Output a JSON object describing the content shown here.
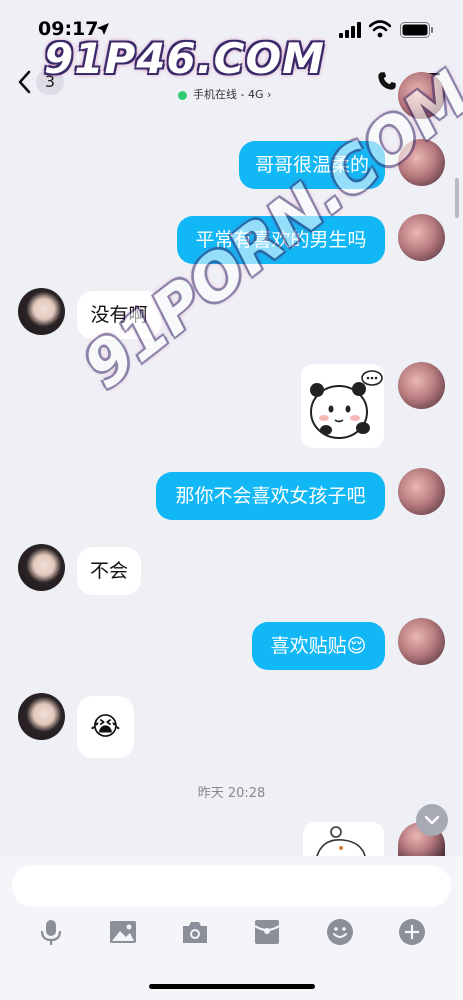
{
  "status_bar": {
    "time": "09:17"
  },
  "header": {
    "unread_count": "3",
    "online_status": "手机在线 - 4G"
  },
  "messages": [
    {
      "side": "me",
      "text": "哥哥很温柔的"
    },
    {
      "side": "me",
      "text": "平常有喜欢的男生吗"
    },
    {
      "side": "her",
      "text": "没有啊"
    },
    {
      "side": "me",
      "type": "sticker",
      "sticker": "panda-thinking-sticker"
    },
    {
      "side": "me",
      "text": "那你不会喜欢女孩子吧"
    },
    {
      "side": "her",
      "text": "不会"
    },
    {
      "side": "me",
      "text": "喜欢贴贴",
      "emoji": "😌"
    },
    {
      "side": "her",
      "type": "emoji",
      "emoji": "😭"
    }
  ],
  "time_separator": "昨天 20:28",
  "input": {
    "placeholder": ""
  },
  "toolbar": [
    "mic-icon",
    "image-icon",
    "camera-icon",
    "red-packet-icon",
    "emoji-icon",
    "plus-icon"
  ],
  "watermark": {
    "top": "91P46.COM",
    "diagonal": "91PORN.COM"
  },
  "colors": {
    "my_bubble": "#12b7f5",
    "her_bubble": "#ffffff",
    "background": "#eff0f6",
    "online_dot": "#2ecc71"
  }
}
